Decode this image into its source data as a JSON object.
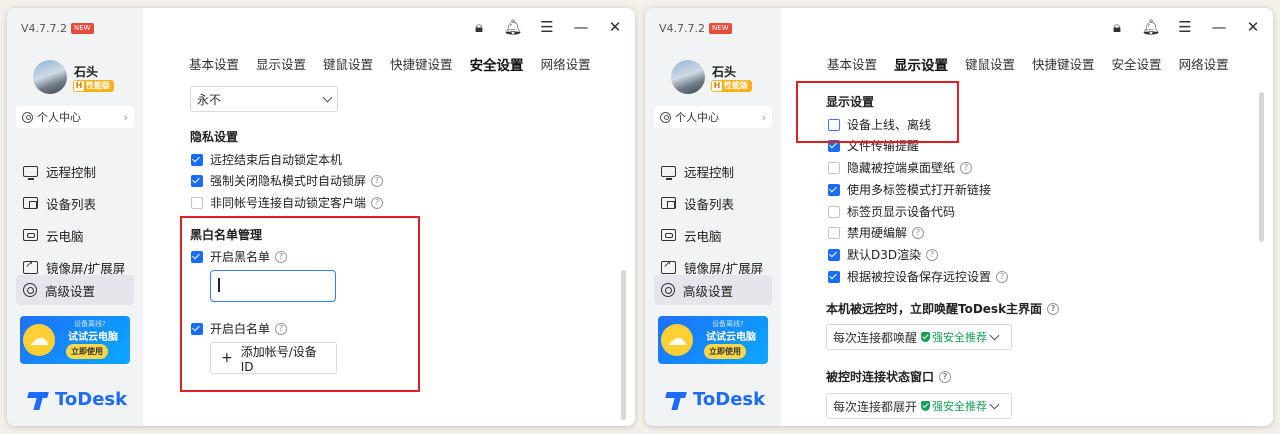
{
  "left_window": {
    "version": "V4.7.7.2",
    "new_badge": "NEW",
    "user": {
      "name": "石头",
      "badge_h": "H",
      "badge_text": "性能版"
    },
    "personal_center": "个人中心",
    "nav": [
      "远程控制",
      "设备列表",
      "云电脑",
      "镜像屏/扩展屏",
      "高级设置"
    ],
    "ad": {
      "line1": "设备离线?",
      "line2": "试试云电脑",
      "button": "立即使用"
    },
    "logo": "ToDesk",
    "tabs": [
      "基本设置",
      "显示设置",
      "键鼠设置",
      "快捷键设置",
      "安全设置",
      "网络设置"
    ],
    "active_tab": "安全设置",
    "lock_select": "永不",
    "privacy": {
      "title": "隐私设置",
      "items": [
        {
          "label": "远控结束后自动锁定本机",
          "checked": true
        },
        {
          "label": "强制关闭隐私模式时自动锁屏",
          "checked": true
        },
        {
          "label": "非同帐号连接自动锁定客户端",
          "checked": false
        }
      ]
    },
    "blackwhite": {
      "title": "黑白名单管理",
      "blacklist_label": "开启黑名单",
      "whitelist_label": "开启白名单",
      "add_button": "添加帐号/设备ID"
    }
  },
  "right_window": {
    "version": "V4.7.7.2",
    "new_badge": "NEW",
    "user": {
      "name": "石头",
      "badge_h": "H",
      "badge_text": "性能版"
    },
    "personal_center": "个人中心",
    "nav": [
      "远程控制",
      "设备列表",
      "云电脑",
      "镜像屏/扩展屏",
      "高级设置"
    ],
    "ad": {
      "line1": "设备离线?",
      "line2": "试试云电脑",
      "button": "立即使用"
    },
    "logo": "ToDesk",
    "tabs": [
      "基本设置",
      "显示设置",
      "键鼠设置",
      "快捷键设置",
      "安全设置",
      "网络设置"
    ],
    "active_tab": "显示设置",
    "display": {
      "title": "显示设置",
      "items": [
        {
          "label": "设备上线、离线",
          "checked": false
        },
        {
          "label": "文件传输提醒",
          "checked": true
        },
        {
          "label": "隐藏被控端桌面壁纸",
          "checked": false
        },
        {
          "label": "使用多标签模式打开新链接",
          "checked": true
        },
        {
          "label": "标签页显示设备代码",
          "checked": false
        },
        {
          "label": "禁用硬编解",
          "checked": false
        },
        {
          "label": "默认D3D渲染",
          "checked": true
        },
        {
          "label": "根据被控设备保存远控设置",
          "checked": true
        }
      ]
    },
    "wake": {
      "title": "本机被远控时，立即唤醒ToDesk主界面",
      "select": "每次连接都唤醒",
      "recommend": "强安全推荐"
    },
    "status_window": {
      "title": "被控时连接状态窗口",
      "select": "每次连接都展开",
      "recommend": "强安全推荐"
    }
  },
  "colors": {
    "accent": "#1a6cff",
    "highlight": "#e02020",
    "recommend": "#1aa056"
  }
}
